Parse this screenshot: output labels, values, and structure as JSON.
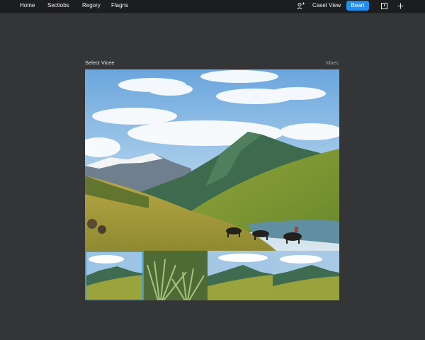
{
  "nav": {
    "items": [
      {
        "label": "Home"
      },
      {
        "label": "Sectiobs"
      },
      {
        "label": "Regory"
      },
      {
        "label": "Flagns"
      }
    ]
  },
  "toolbar": {
    "icons": [
      "user-share-icon",
      "panel-icon",
      "plus-icon"
    ],
    "reset_view_label": "Caset View",
    "primary_label": "Beart"
  },
  "panel": {
    "title": "Select Vicee",
    "corner_label": "Maec"
  },
  "thumbnails": {
    "count": 4,
    "selected_index": 0
  },
  "colors": {
    "accent": "#1f8ef1",
    "selection": "#3a9bdc",
    "background": "#343536",
    "topbar": "#1c1d1f"
  }
}
